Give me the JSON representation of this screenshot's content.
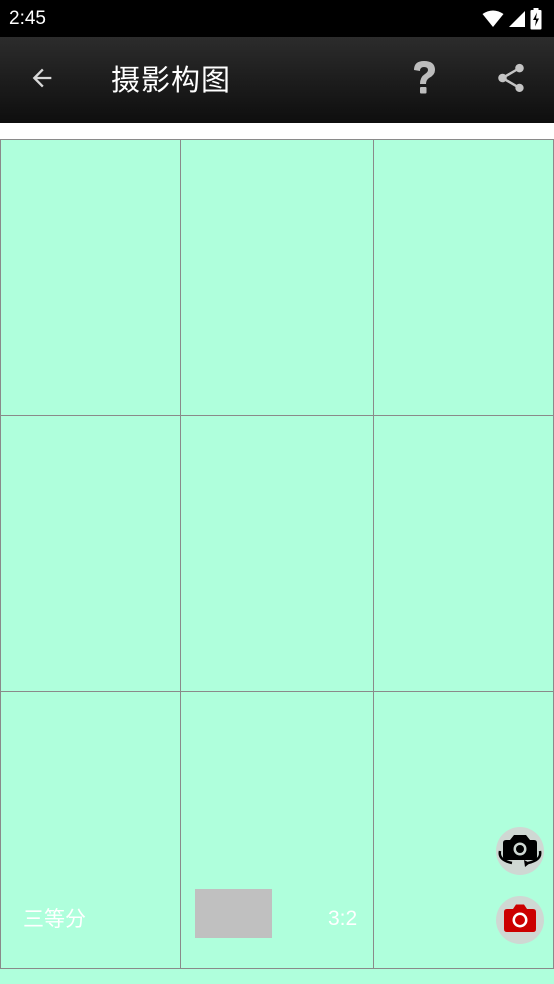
{
  "status_bar": {
    "time": "2:45",
    "icons": [
      "wifi-icon",
      "cell-signal-icon",
      "battery-charging-icon"
    ]
  },
  "app_bar": {
    "title": "摄影构图",
    "back_icon": "arrow-back-icon",
    "help_icon": "question-mark-icon",
    "share_icon": "share-icon"
  },
  "composition": {
    "grid_color": "#afffdc",
    "line_color": "#8a8a8a",
    "mode_label": "三等分",
    "ratio_label": "3:2"
  },
  "actions": {
    "flip_camera_icon": "camera-flip-icon",
    "capture_icon": "camera-icon",
    "capture_color": "#cc0000"
  }
}
